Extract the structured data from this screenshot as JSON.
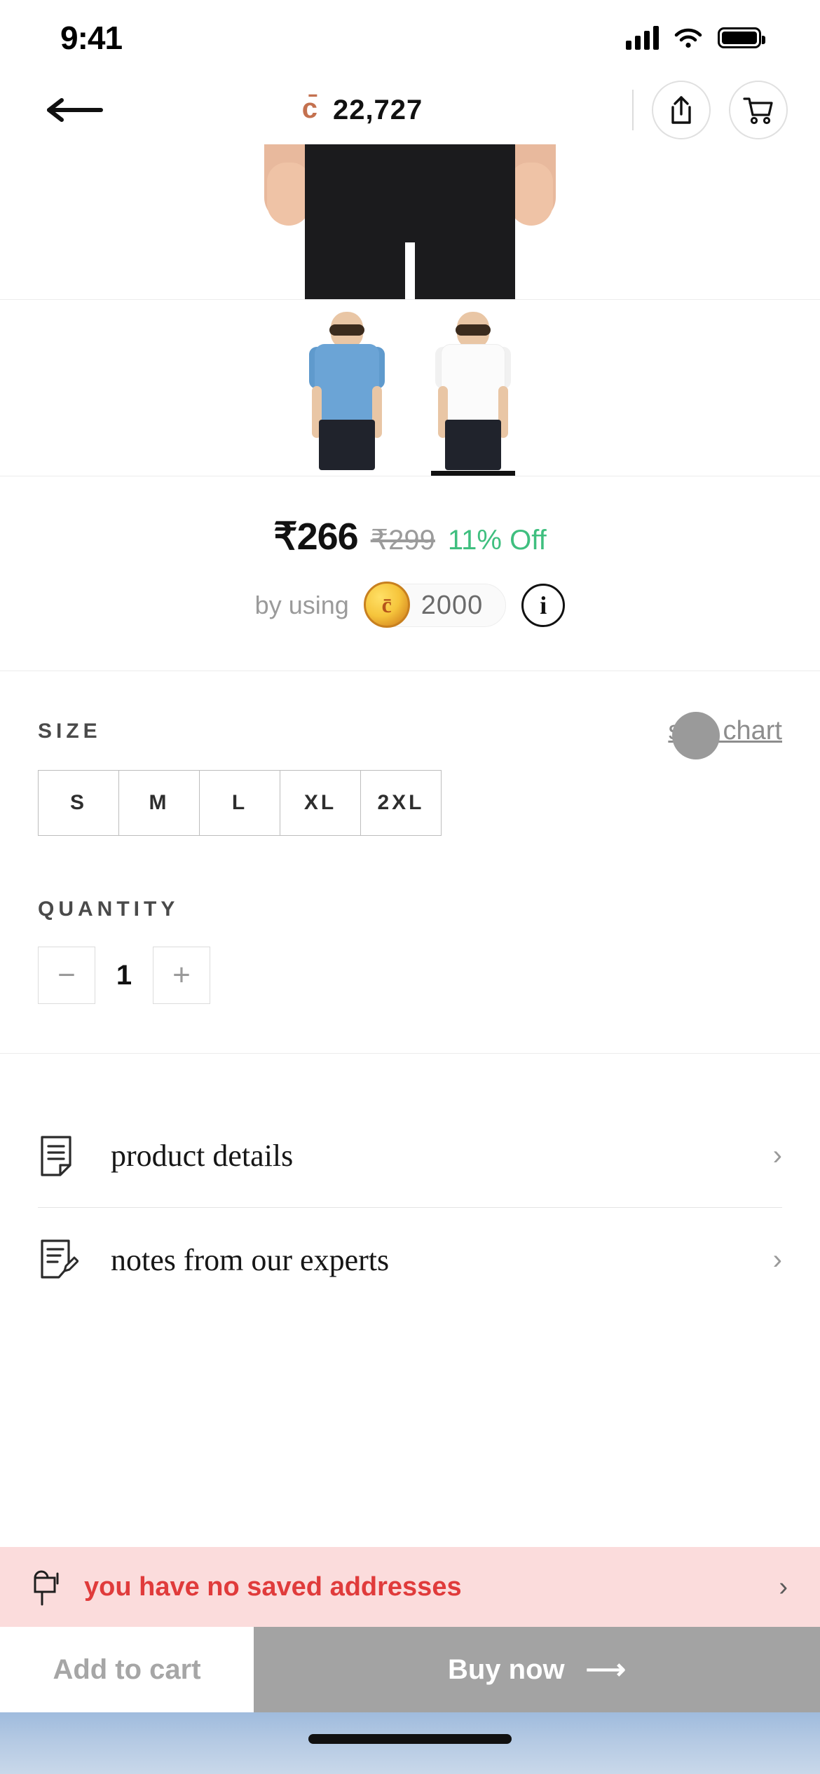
{
  "status_bar": {
    "time": "9:41",
    "signal_icon": "cellular-signal-icon",
    "wifi_icon": "wifi-icon",
    "battery_icon": "battery-full-icon"
  },
  "header": {
    "back_icon": "back-arrow-icon",
    "coin_symbol": "c̄",
    "coin_balance": "22,727",
    "share_icon": "share-icon",
    "cart_icon": "shopping-cart-icon"
  },
  "gallery": {
    "thumbnails": [
      {
        "name": "blue-tshirt-thumbnail",
        "color_label": "blue",
        "selected": false
      },
      {
        "name": "white-tshirt-thumbnail",
        "color_label": "white",
        "selected": true
      }
    ]
  },
  "price": {
    "current": "₹266",
    "original": "₹299",
    "discount": "11% Off",
    "by_using_label": "by using",
    "coin_symbol": "c̄",
    "coin_amount": "2000",
    "info_icon": "info-icon",
    "info_label": "i",
    "discount_color": "#3fbf7f"
  },
  "size": {
    "title": "SIZE",
    "chart_link": "size chart",
    "options": [
      "S",
      "M",
      "L",
      "XL",
      "2XL"
    ],
    "selected": null
  },
  "quantity": {
    "title": "QUANTITY",
    "decrement_label": "−",
    "increment_label": "+",
    "value": "1"
  },
  "accordions": [
    {
      "icon": "document-lines-icon",
      "label": "product details",
      "chevron": "›"
    },
    {
      "icon": "note-pencil-icon",
      "label": "notes from our experts",
      "chevron": "›"
    }
  ],
  "address_banner": {
    "icon": "mailbox-icon",
    "text": "you have no saved addresses",
    "chevron": "›",
    "background_color": "#fbdcdc",
    "text_color": "#e03b3b"
  },
  "bottom_bar": {
    "add_to_cart_label": "Add to cart",
    "buy_now_label": "Buy now",
    "buy_now_arrow": "⟶",
    "buy_now_background": "#a3a3a3"
  }
}
